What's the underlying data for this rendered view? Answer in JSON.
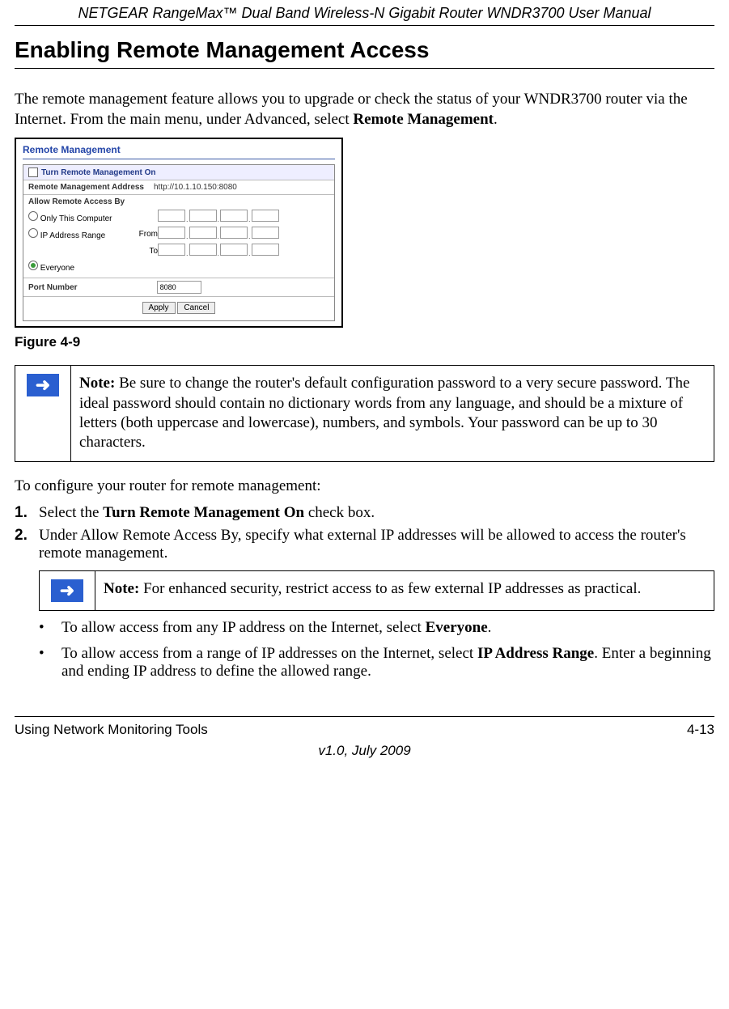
{
  "header": {
    "book_title": "NETGEAR RangeMax™ Dual Band Wireless-N Gigabit Router WNDR3700 User Manual"
  },
  "section": {
    "heading": "Enabling Remote Management Access",
    "intro_a": "The remote management feature allows you to upgrade or check the status of your WNDR3700 router via the Internet. From the main menu, under Advanced, select ",
    "intro_bold": "Remote Management",
    "intro_b": "."
  },
  "figure": {
    "caption": "Figure 4-9",
    "title": "Remote Management",
    "turn_on_label": "Turn Remote Management On",
    "address_label": "Remote Management Address",
    "address_value": "http://10.1.10.150:8080",
    "access_heading": "Allow Remote Access By",
    "radio1": "Only This Computer",
    "radio2": "IP Address Range",
    "from": "From",
    "to": "To",
    "radio3": "Everyone",
    "port_label": "Port Number",
    "port_value": "8080",
    "btn_apply": "Apply",
    "btn_cancel": "Cancel"
  },
  "note1": {
    "label": "Note:",
    "text": " Be sure to change the router's default configuration password to a very secure password. The ideal password should contain no dictionary words from any language, and should be a mixture of letters (both uppercase and lowercase), numbers, and symbols. Your password can be up to 30 characters."
  },
  "config_intro": "To configure your router for remote management:",
  "steps": {
    "s1_num": "1.",
    "s1_a": "Select the ",
    "s1_bold": "Turn Remote Management On",
    "s1_b": " check box.",
    "s2_num": "2.",
    "s2_text": "Under Allow Remote Access By, specify what external IP addresses will be allowed to access the router's remote management."
  },
  "note2": {
    "label": "Note:",
    "text": " For enhanced security, restrict access to as few external IP addresses as practical."
  },
  "bullets": {
    "b1_a": "To allow access from any IP address on the Internet, select ",
    "b1_bold": "Everyone",
    "b1_b": ".",
    "b2_a": "To allow access from a range of IP addresses on the Internet, select ",
    "b2_bold": "IP Address Range",
    "b2_b": ". Enter a beginning and ending IP address to define the allowed range."
  },
  "footer": {
    "left": "Using Network Monitoring Tools",
    "right": "4-13",
    "version": "v1.0, July 2009"
  }
}
